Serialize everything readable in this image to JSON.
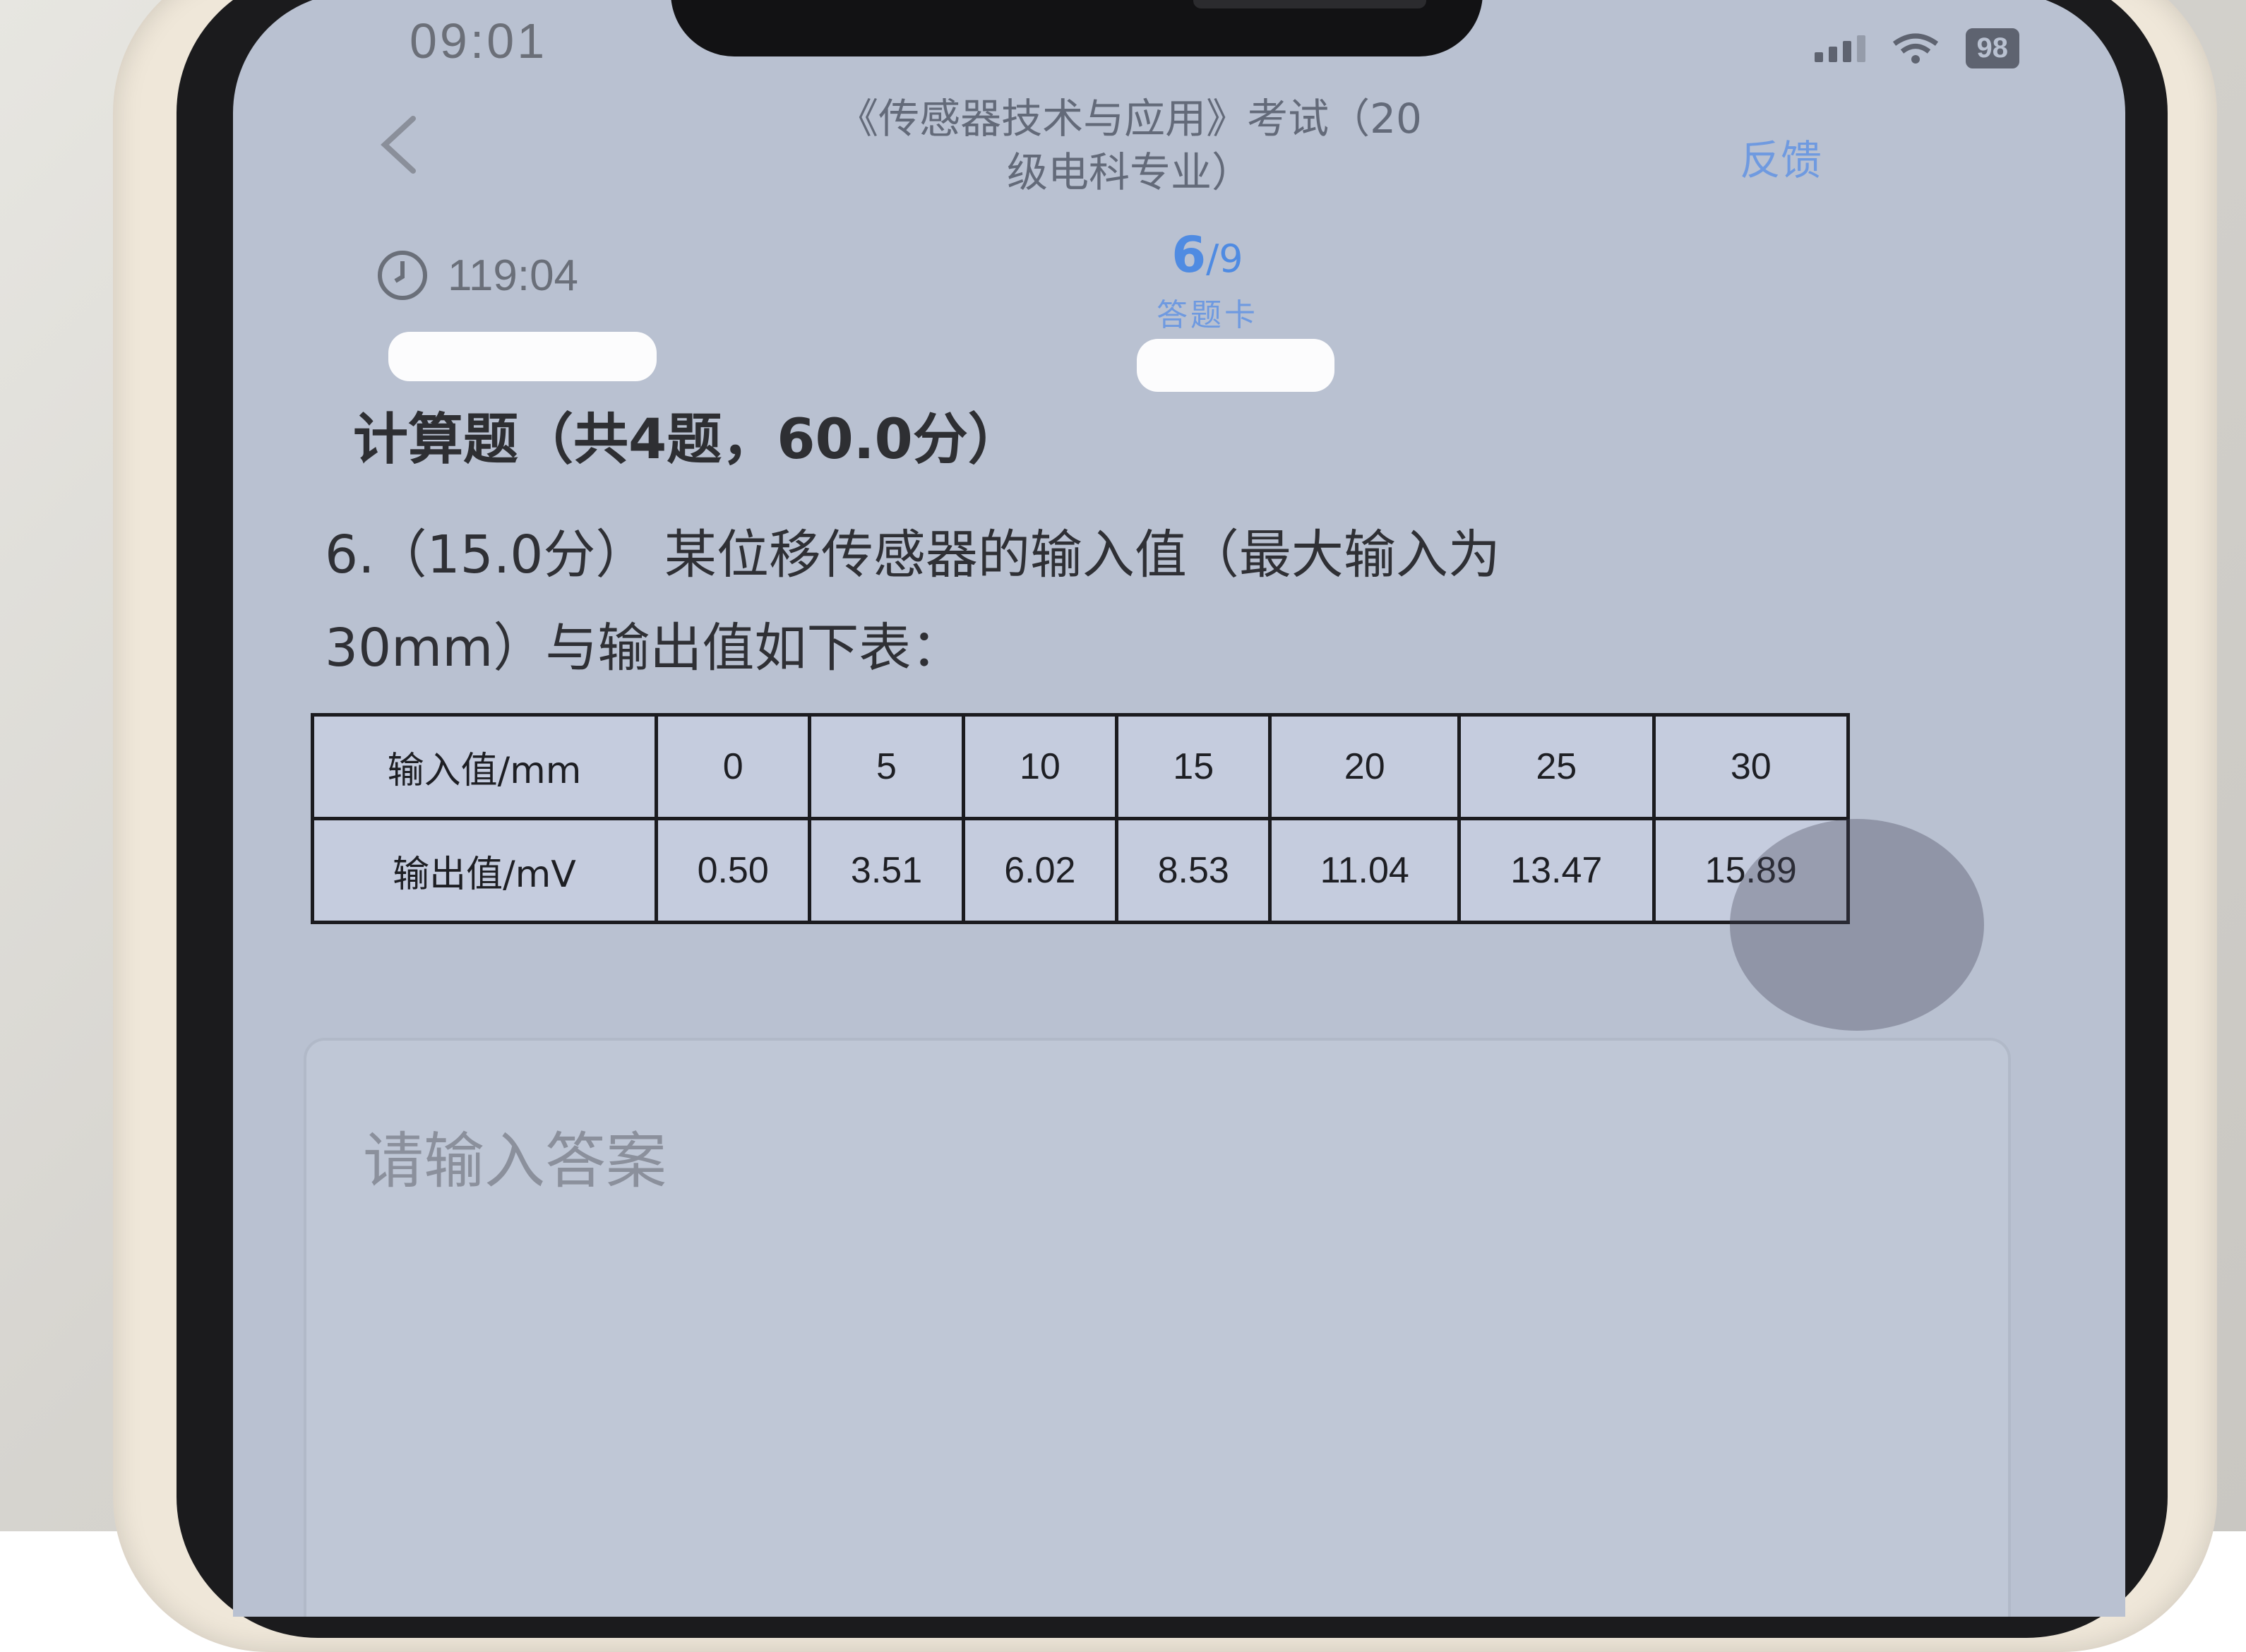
{
  "status_bar": {
    "time": "09:01",
    "battery": "98"
  },
  "header": {
    "title_line1": "《传感器技术与应用》考试（20",
    "title_line2": "级电科专业）",
    "feedback": "反馈"
  },
  "exam": {
    "timer": "119:04",
    "current_question": "6",
    "separator": "/",
    "total_questions": "9",
    "answer_card": "答题卡"
  },
  "section": {
    "title": "计算题（共4题，60.0分）"
  },
  "question": {
    "line1": "6.（15.0分） 某位移传感器的输入值（最大输入为",
    "line2": "30mm）与输出值如下表："
  },
  "table": {
    "rows": [
      {
        "label": "输入值/mm",
        "cells": [
          "0",
          "5",
          "10",
          "15",
          "20",
          "25",
          "30"
        ]
      },
      {
        "label": "输出值/mV",
        "cells": [
          "0.50",
          "3.51",
          "6.02",
          "8.53",
          "11.04",
          "13.47",
          "15.89"
        ]
      }
    ]
  },
  "answer": {
    "placeholder": "请输入答案"
  },
  "icons": {
    "back": "chevron-left-icon",
    "clock": "clock-icon",
    "signal": "signal-icon",
    "wifi": "wifi-icon",
    "battery": "battery-icon"
  }
}
